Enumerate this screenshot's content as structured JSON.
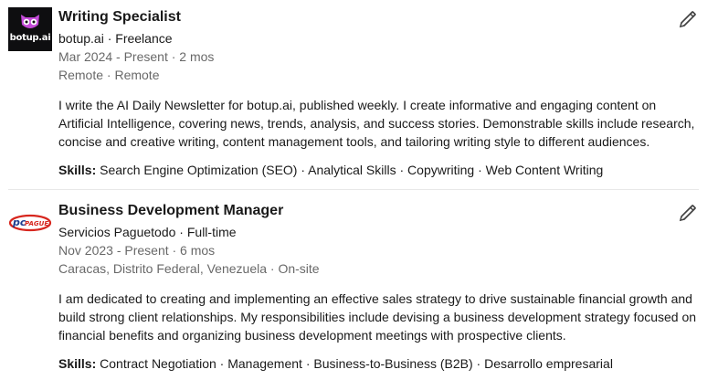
{
  "experiences": [
    {
      "title": "Writing Specialist",
      "company": "botup.ai · Freelance",
      "dates": "Mar 2024 - Present · 2 mos",
      "location": "Remote · Remote",
      "description": "I write the AI Daily Newsletter for botup.ai, published weekly. I create informative and engaging content on Artificial Intelligence, covering news, trends, analysis, and success stories. Demonstrable skills include research, concise and creative writing, content management tools, and tailoring writing style to different audiences.",
      "skills_label": "Skills:",
      "skills": "Search Engine Optimization (SEO) · Analytical Skills · Copywriting · Web Content Writing",
      "logo_text": "botup.ai",
      "logo_icon": "owl-icon",
      "edit_icon": "pencil-icon"
    },
    {
      "title": "Business Development Manager",
      "company": "Servicios Paguetodo · Full-time",
      "dates": "Nov 2023 - Present · 6 mos",
      "location": "Caracas, Distrito Federal, Venezuela · On-site",
      "description": "I am dedicated to creating and implementing an effective sales strategy to drive sustainable financial growth and build strong client relationships. My responsibilities include devising a business development strategy focused on financial benefits and organizing business development meetings with prospective clients.",
      "skills_label": "Skills:",
      "skills": "Contract Negotiation · Management · Business-to-Business (B2B) · Desarrollo empresarial",
      "logo_text": "paguetodo",
      "edit_icon": "pencil-icon"
    }
  ],
  "colors": {
    "primary_text": "#1f1f1f",
    "secondary_text": "#666666",
    "botup_bg": "#0e0e10",
    "botup_accent": "#c44bd8",
    "pagueto_red": "#d7261e",
    "pagueto_blue": "#1d3c8f"
  }
}
